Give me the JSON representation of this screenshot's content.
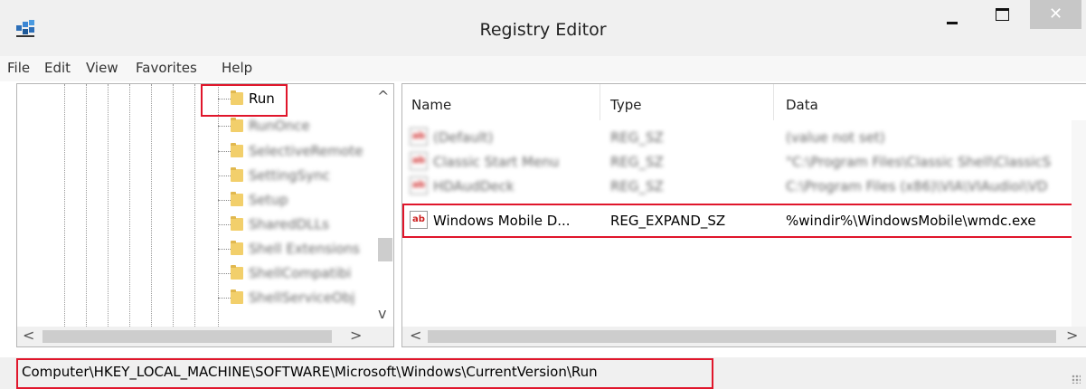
{
  "window": {
    "title": "Registry Editor",
    "close_glyph": "✕"
  },
  "menu": [
    "File",
    "Edit",
    "View",
    "Favorites",
    "Help"
  ],
  "tree": {
    "items": [
      {
        "label": "Run",
        "blurred": false,
        "selected": true
      },
      {
        "label": "RunOnce",
        "blurred": true
      },
      {
        "label": "SelectiveRemote",
        "blurred": true
      },
      {
        "label": "SettingSync",
        "blurred": true
      },
      {
        "label": "Setup",
        "blurred": true
      },
      {
        "label": "SharedDLLs",
        "blurred": true
      },
      {
        "label": "Shell Extensions",
        "blurred": true
      },
      {
        "label": "ShellCompatibi",
        "blurred": true
      },
      {
        "label": "ShellServiceObj",
        "blurred": true
      }
    ],
    "scroll_up": "^",
    "scroll_down": "v",
    "scroll_left": "<",
    "scroll_right": ">"
  },
  "list": {
    "columns": [
      "Name",
      "Type",
      "Data"
    ],
    "rows": [
      {
        "name": "(Default)",
        "type": "REG_SZ",
        "data": "(value not set)",
        "blurred": true
      },
      {
        "name": "Classic Start Menu",
        "type": "REG_SZ",
        "data": "\"C:\\Program Files\\Classic Shell\\ClassicS",
        "blurred": true
      },
      {
        "name": "HDAudDeck",
        "type": "REG_SZ",
        "data": "C:\\Program Files (x86)\\VIA\\VIAudioi\\VD",
        "blurred": true
      },
      {
        "name": "Windows Mobile D...",
        "type": "REG_EXPAND_SZ",
        "data": "%windir%\\WindowsMobile\\wmdc.exe",
        "blurred": false,
        "highlighted": true
      }
    ],
    "icon_text": "ab",
    "scroll_left": "<",
    "scroll_right": ">"
  },
  "status": {
    "path": "Computer\\HKEY_LOCAL_MACHINE\\SOFTWARE\\Microsoft\\Windows\\CurrentVersion\\Run"
  },
  "colors": {
    "highlight": "#e0162b",
    "folder": "#f2cf6b",
    "icon_red": "#cc2020",
    "close_button": "#c7c7c7"
  }
}
